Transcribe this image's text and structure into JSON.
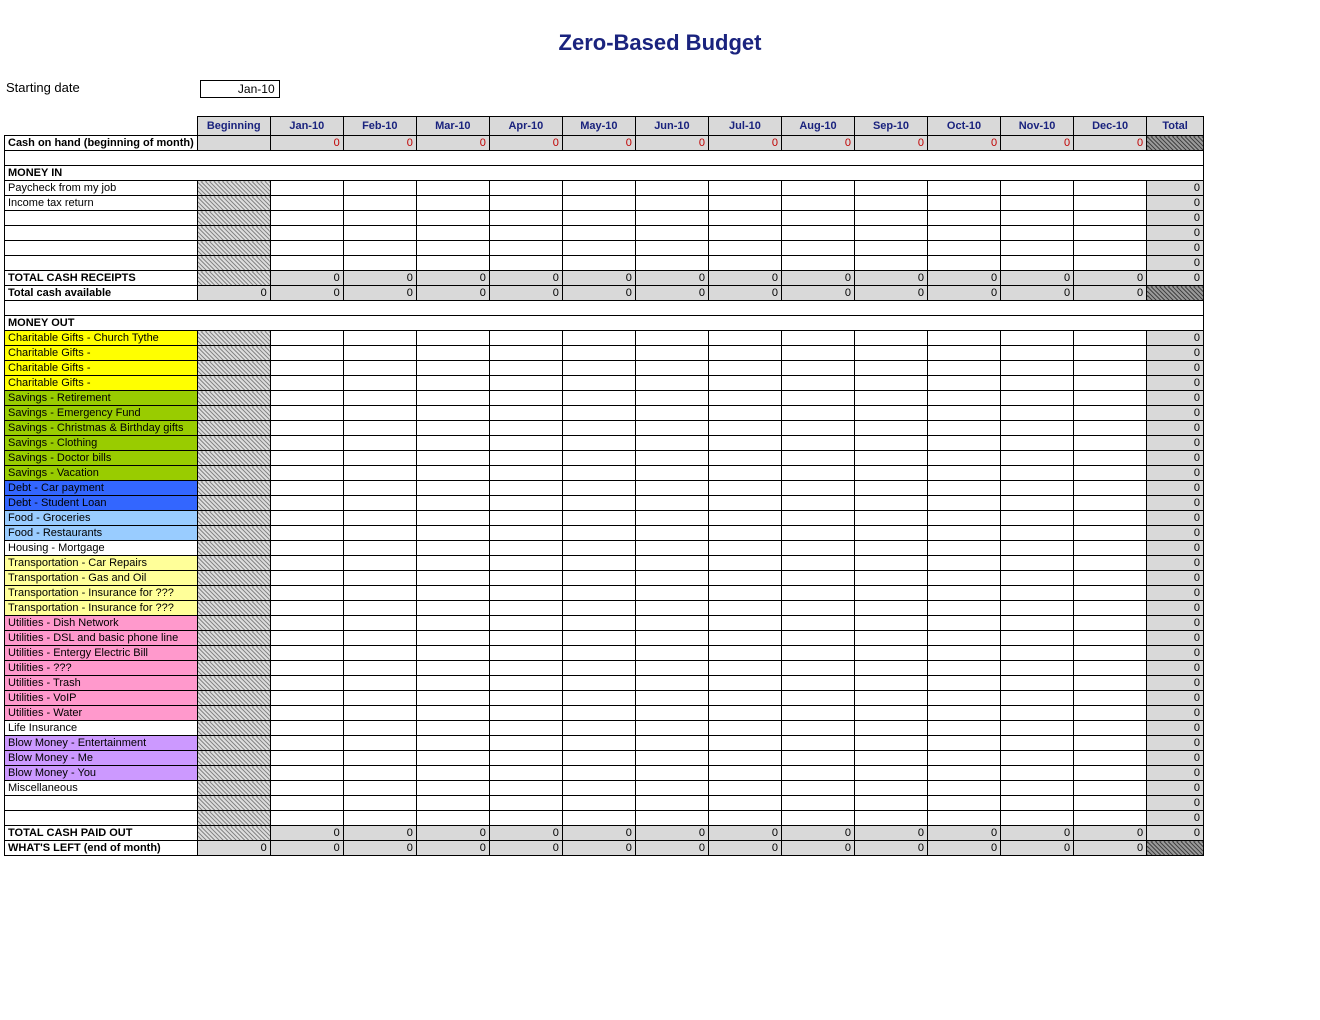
{
  "title": "Zero-Based Budget",
  "starting_date_label": "Starting date",
  "starting_date_value": "Jan-10",
  "columns": [
    "Beginning",
    "Jan-10",
    "Feb-10",
    "Mar-10",
    "Apr-10",
    "May-10",
    "Jun-10",
    "Jul-10",
    "Aug-10",
    "Sep-10",
    "Oct-10",
    "Nov-10",
    "Dec-10",
    "Total"
  ],
  "cash_on_hand_label": "Cash on hand (beginning of month)",
  "zero": "0",
  "money_in_hdr": "MONEY IN",
  "money_in_rows": [
    "Paycheck from my job",
    "Income tax return",
    "",
    "",
    "",
    ""
  ],
  "total_cash_receipts_label": "TOTAL CASH RECEIPTS",
  "total_cash_available_label": "Total cash available",
  "money_out_hdr": "MONEY OUT",
  "money_out_rows": [
    {
      "label": "Charitable Gifts - Church Tythe",
      "color": "c-yellow"
    },
    {
      "label": "Charitable Gifts -",
      "color": "c-yellow"
    },
    {
      "label": "Charitable Gifts -",
      "color": "c-yellow"
    },
    {
      "label": "Charitable Gifts -",
      "color": "c-yellow"
    },
    {
      "label": "Savings - Retirement",
      "color": "c-green"
    },
    {
      "label": "Savings - Emergency Fund",
      "color": "c-green"
    },
    {
      "label": "Savings - Christmas & Birthday gifts",
      "color": "c-green"
    },
    {
      "label": "Savings - Clothing",
      "color": "c-green"
    },
    {
      "label": "Savings - Doctor bills",
      "color": "c-green"
    },
    {
      "label": "Savings - Vacation",
      "color": "c-green"
    },
    {
      "label": "Debt - Car payment",
      "color": "c-blue"
    },
    {
      "label": "Debt - Student Loan",
      "color": "c-blue"
    },
    {
      "label": "Food - Groceries",
      "color": "c-lblue"
    },
    {
      "label": "Food - Restaurants",
      "color": "c-lblue"
    },
    {
      "label": "Housing - Mortgage",
      "color": "c-white"
    },
    {
      "label": "Transportation - Car Repairs",
      "color": "c-cream"
    },
    {
      "label": "Transportation - Gas and Oil",
      "color": "c-cream"
    },
    {
      "label": "Transportation - Insurance for ???",
      "color": "c-cream"
    },
    {
      "label": "Transportation - Insurance for ???",
      "color": "c-cream"
    },
    {
      "label": "Utilities - Dish Network",
      "color": "c-pink"
    },
    {
      "label": "Utilities - DSL and basic phone line",
      "color": "c-pink"
    },
    {
      "label": "Utilities - Entergy Electric Bill",
      "color": "c-pink"
    },
    {
      "label": "Utilities - ???",
      "color": "c-pink"
    },
    {
      "label": "Utilities - Trash",
      "color": "c-pink"
    },
    {
      "label": "Utilities - VoIP",
      "color": "c-pink"
    },
    {
      "label": "Utilities - Water",
      "color": "c-pink"
    },
    {
      "label": "Life Insurance",
      "color": "c-white"
    },
    {
      "label": "Blow Money - Entertainment",
      "color": "c-purple"
    },
    {
      "label": "Blow Money - Me",
      "color": "c-purple"
    },
    {
      "label": "Blow Money - You",
      "color": "c-purple"
    },
    {
      "label": "Miscellaneous",
      "color": "c-white"
    },
    {
      "label": "",
      "color": "c-white"
    },
    {
      "label": "",
      "color": "c-white"
    }
  ],
  "total_cash_paid_label": "TOTAL CASH PAID OUT",
  "whats_left_label": "WHAT'S LEFT (end of month)"
}
